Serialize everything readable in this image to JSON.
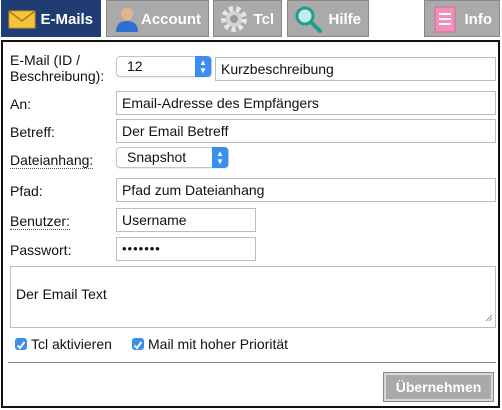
{
  "tabs": {
    "emails": "E-Mails",
    "account": "Account",
    "tcl": "Tcl",
    "hilfe": "Hilfe",
    "info": "Info"
  },
  "form": {
    "email_id_label_line1": "E-Mail (ID /",
    "email_id_label_line2": "Beschreibung):",
    "email_id_value": "12",
    "description_placeholder": "Kurzbeschreibung",
    "to_label": "An:",
    "to_placeholder": "Email-Adresse des Empfängers",
    "subject_label": "Betreff:",
    "subject_placeholder": "Der Email Betreff",
    "attachment_label": "Dateianhang:",
    "attachment_value": "Snapshot",
    "path_label": "Pfad:",
    "path_placeholder": "Pfad zum Dateianhang",
    "user_label": "Benutzer:",
    "user_placeholder": "Username",
    "password_label": "Passwort:",
    "password_value": "•••••••",
    "body_placeholder": "Der Email Text",
    "tcl_enable_label": "Tcl aktivieren",
    "tcl_enable_checked": true,
    "high_priority_label": "Mail mit hoher Priorität",
    "high_priority_checked": true,
    "submit_label": "Übernehmen"
  },
  "colors": {
    "active_tab": "#1f3c73",
    "inactive_tab": "#aaaaaa",
    "accent": "#3b8ef0"
  }
}
